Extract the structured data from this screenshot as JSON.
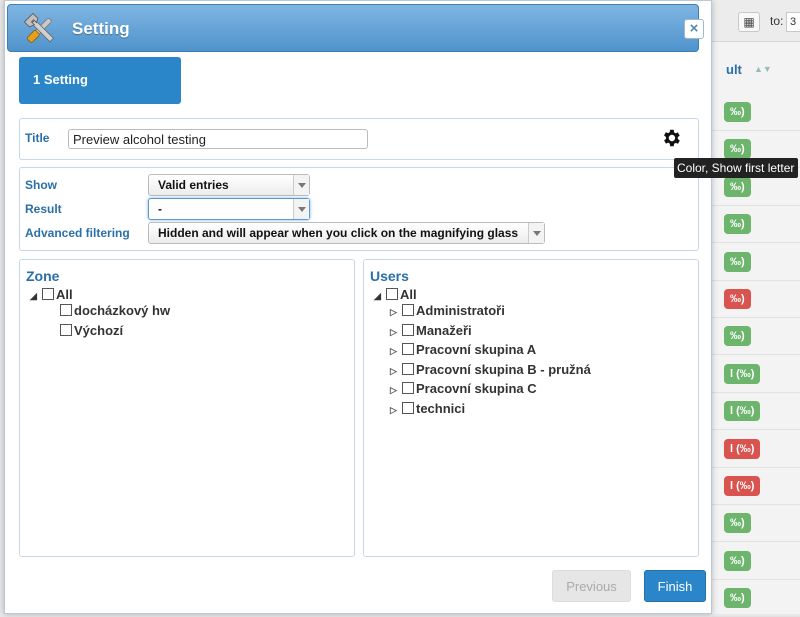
{
  "background": {
    "to_label": "to:",
    "to_value": "3",
    "column_header": "ult",
    "rows": [
      {
        "text": "‰)",
        "status": "green"
      },
      {
        "text": "‰)",
        "status": "green"
      },
      {
        "text": "‰)",
        "status": "green"
      },
      {
        "text": "‰)",
        "status": "green"
      },
      {
        "text": "‰)",
        "status": "green"
      },
      {
        "text": "‰)",
        "status": "red"
      },
      {
        "text": "‰)",
        "status": "green"
      },
      {
        "text": "l (‰)",
        "status": "green"
      },
      {
        "text": "l (‰)",
        "status": "green"
      },
      {
        "text": "l (‰)",
        "status": "red"
      },
      {
        "text": "l (‰)",
        "status": "red"
      },
      {
        "text": "‰)",
        "status": "green"
      },
      {
        "text": "‰)",
        "status": "green"
      },
      {
        "text": "‰)",
        "status": "green"
      }
    ]
  },
  "dialog": {
    "title": "Setting",
    "close_glyph": "×",
    "step_tab": "1 Setting",
    "title_label": "Title",
    "title_value": "Preview alcohol testing",
    "tooltip": "Color, Show first letter",
    "filters": {
      "show_label": "Show",
      "show_value": "Valid entries",
      "result_label": "Result",
      "result_value": "-",
      "advanced_label": "Advanced filtering",
      "advanced_value": "Hidden and will appear when you click on the magnifying glass"
    },
    "zone": {
      "title": "Zone",
      "root": "All",
      "children": [
        "docházkový hw",
        "Výchozí"
      ]
    },
    "users": {
      "title": "Users",
      "root": "All",
      "children": [
        "Administratoři",
        "Manažeři",
        "Pracovní skupina A",
        "Pracovní skupina B - pružná",
        "Pracovní skupina C",
        "technici"
      ]
    },
    "buttons": {
      "previous": "Previous",
      "finish": "Finish"
    }
  },
  "colors": {
    "accent": "#2a86c8",
    "label_blue": "#2a6fa8",
    "status_green": "#6db56d",
    "status_red": "#d9534f"
  }
}
